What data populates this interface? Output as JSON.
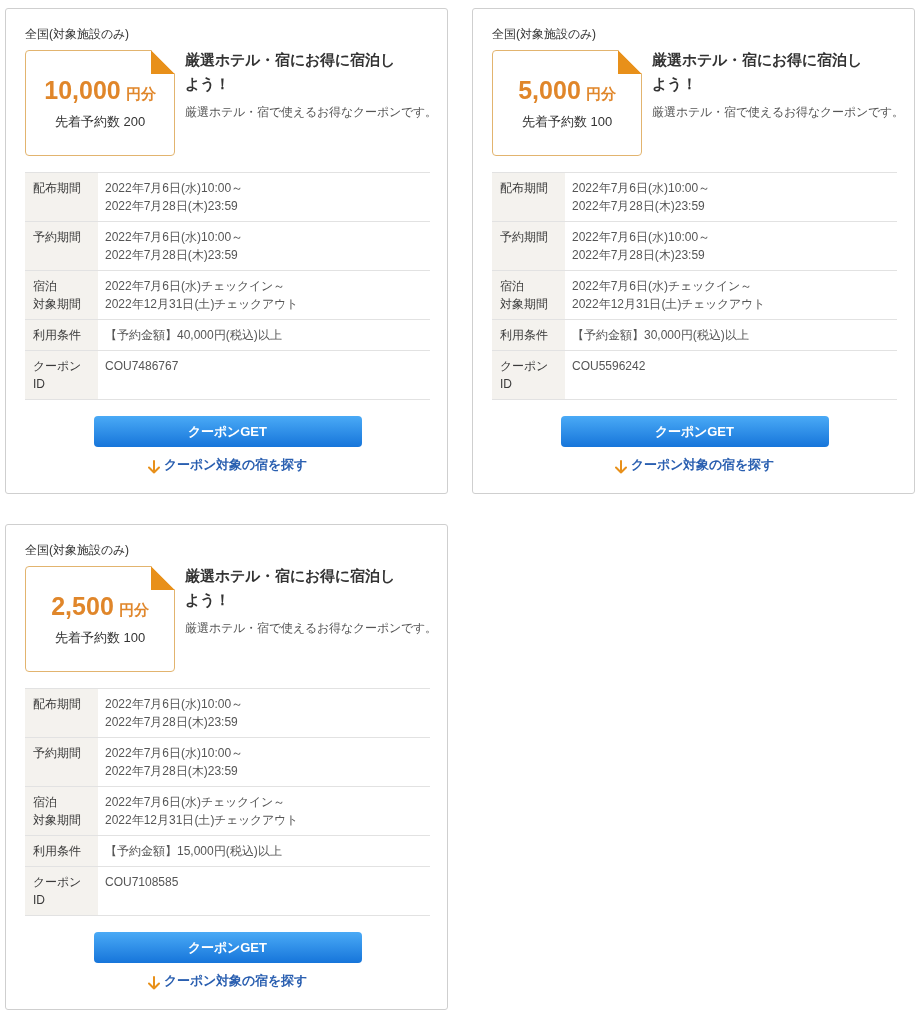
{
  "coupons": [
    {
      "region": "全国(対象施設のみ)",
      "amount": "10,000",
      "unit": "円分",
      "quota": "先着予約数 200",
      "title": "厳選ホテル・宿にお得に宿泊しよう！",
      "description": "厳選ホテル・宿で使えるお得なクーポンです。",
      "details": [
        {
          "label": [
            "配布期間"
          ],
          "value": [
            "2022年7月6日(水)10:00～",
            "2022年7月28日(木)23:59"
          ]
        },
        {
          "label": [
            "予約期間"
          ],
          "value": [
            "2022年7月6日(水)10:00～",
            "2022年7月28日(木)23:59"
          ]
        },
        {
          "label": [
            "宿泊",
            "対象期間"
          ],
          "value": [
            "2022年7月6日(水)チェックイン～",
            "2022年12月31日(土)チェックアウト"
          ]
        },
        {
          "label": [
            "利用条件"
          ],
          "value": [
            "【予約金額】40,000円(税込)以上"
          ]
        },
        {
          "label": [
            "クーポン",
            "ID"
          ],
          "value": [
            "COU7486767"
          ]
        }
      ],
      "button": "クーポンGET",
      "link": "クーポン対象の宿を探す"
    },
    {
      "region": "全国(対象施設のみ)",
      "amount": "5,000",
      "unit": "円分",
      "quota": "先着予約数 100",
      "title": "厳選ホテル・宿にお得に宿泊しよう！",
      "description": "厳選ホテル・宿で使えるお得なクーポンです。",
      "details": [
        {
          "label": [
            "配布期間"
          ],
          "value": [
            "2022年7月6日(水)10:00～",
            "2022年7月28日(木)23:59"
          ]
        },
        {
          "label": [
            "予約期間"
          ],
          "value": [
            "2022年7月6日(水)10:00～",
            "2022年7月28日(木)23:59"
          ]
        },
        {
          "label": [
            "宿泊",
            "対象期間"
          ],
          "value": [
            "2022年7月6日(水)チェックイン～",
            "2022年12月31日(土)チェックアウト"
          ]
        },
        {
          "label": [
            "利用条件"
          ],
          "value": [
            "【予約金額】30,000円(税込)以上"
          ]
        },
        {
          "label": [
            "クーポン",
            "ID"
          ],
          "value": [
            "COU5596242"
          ]
        }
      ],
      "button": "クーポンGET",
      "link": "クーポン対象の宿を探す"
    },
    {
      "region": "全国(対象施設のみ)",
      "amount": "2,500",
      "unit": "円分",
      "quota": "先着予約数 100",
      "title": "厳選ホテル・宿にお得に宿泊しよう！",
      "description": "厳選ホテル・宿で使えるお得なクーポンです。",
      "details": [
        {
          "label": [
            "配布期間"
          ],
          "value": [
            "2022年7月6日(水)10:00～",
            "2022年7月28日(木)23:59"
          ]
        },
        {
          "label": [
            "予約期間"
          ],
          "value": [
            "2022年7月6日(水)10:00～",
            "2022年7月28日(木)23:59"
          ]
        },
        {
          "label": [
            "宿泊",
            "対象期間"
          ],
          "value": [
            "2022年7月6日(水)チェックイン～",
            "2022年12月31日(土)チェックアウト"
          ]
        },
        {
          "label": [
            "利用条件"
          ],
          "value": [
            "【予約金額】15,000円(税込)以上"
          ]
        },
        {
          "label": [
            "クーポン",
            "ID"
          ],
          "value": [
            "COU7108585"
          ]
        }
      ],
      "button": "クーポンGET",
      "link": "クーポン対象の宿を探す"
    }
  ]
}
